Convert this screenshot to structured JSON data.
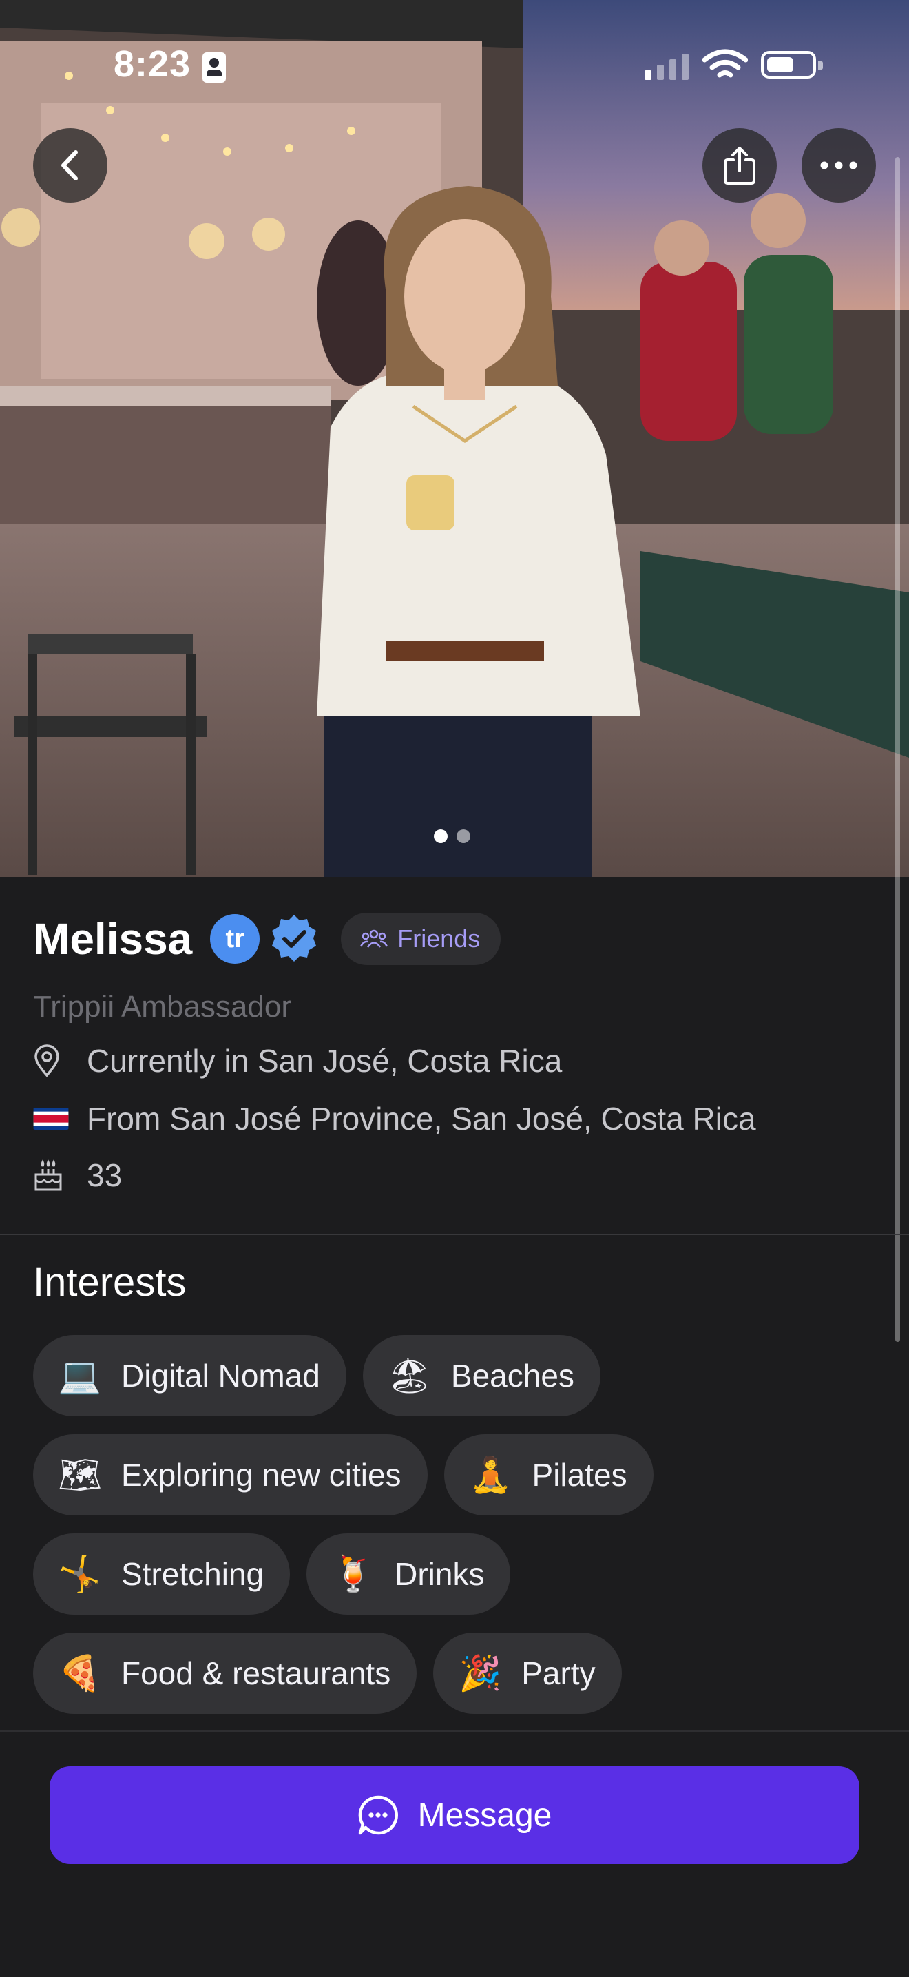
{
  "status_bar": {
    "time": "8:23"
  },
  "hero": {
    "photo_count": 2,
    "active_photo": 1
  },
  "profile": {
    "name": "Melissa",
    "badge_letter": "tr",
    "friends_label": "Friends",
    "role": "Trippii Ambassador",
    "current_location": "Currently in San José, Costa Rica",
    "hometown": "From San José Province, San José, Costa Rica",
    "age": "33"
  },
  "interests": {
    "title": "Interests",
    "items": [
      {
        "label": "Digital Nomad",
        "icon": "laptop-icon"
      },
      {
        "label": "Beaches",
        "icon": "beach-umbrella-icon"
      },
      {
        "label": "Exploring new cities",
        "icon": "map-icon"
      },
      {
        "label": "Pilates",
        "icon": "meditation-icon"
      },
      {
        "label": "Stretching",
        "icon": "cartwheel-icon"
      },
      {
        "label": "Drinks",
        "icon": "tropical-drink-icon"
      },
      {
        "label": "Food & restaurants",
        "icon": "pizza-icon"
      },
      {
        "label": "Party",
        "icon": "party-popper-icon"
      }
    ]
  },
  "actions": {
    "message_label": "Message"
  },
  "colors": {
    "accent": "#5a2fe6",
    "friends": "#a69cf6",
    "verified": "#4b8ef0",
    "background": "#1c1c1e"
  }
}
